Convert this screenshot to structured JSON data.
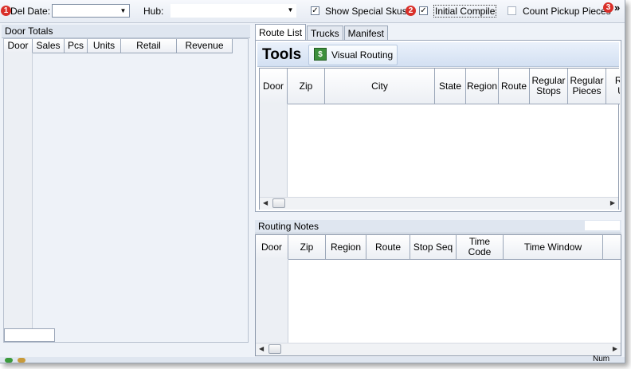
{
  "toolbar": {
    "badges": [
      "1",
      "2",
      "3"
    ],
    "del_date_label": "Del Date:",
    "del_date_value": "",
    "hub_label": "Hub:",
    "hub_value": "",
    "show_special_skus_label": "Show Special Skus",
    "show_special_skus_checked": true,
    "initial_compile_label": "Initial Compile",
    "initial_compile_checked": true,
    "count_pickup_label": "Count Pickup Pieces",
    "count_pickup_checked": false,
    "overflow_glyph": "»"
  },
  "door_totals": {
    "title": "Door Totals",
    "columns": [
      "Door",
      "Sales",
      "Pcs",
      "Units",
      "Retail",
      "Revenue"
    ]
  },
  "tabs": [
    "Route List",
    "Trucks",
    "Manifest"
  ],
  "tools": {
    "title": "Tools",
    "visual_routing_label": "Visual Routing"
  },
  "route_list": {
    "columns": [
      "Door",
      "Zip",
      "City",
      "State",
      "Region",
      "Route",
      "Regular Stops",
      "Regular Pieces",
      "Re U"
    ]
  },
  "routing_notes": {
    "title": "Routing Notes",
    "columns": [
      "Door",
      "Zip",
      "Region",
      "Route",
      "Stop Seq",
      "Time Code",
      "Time Window"
    ]
  },
  "status": {
    "num": "Num"
  },
  "colors": {
    "badge": "#d9302a",
    "header_bg": "#dfe6f0",
    "tools_bg": "#dbe6f5"
  }
}
